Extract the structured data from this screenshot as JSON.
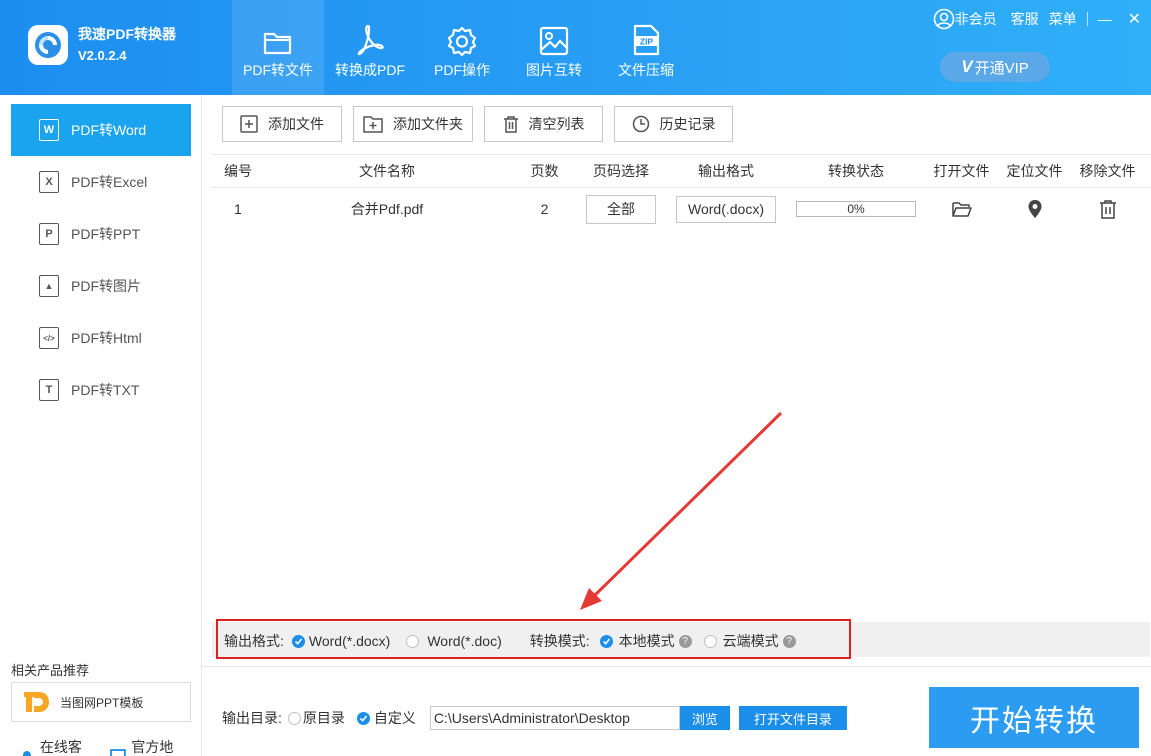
{
  "app": {
    "name": "我速PDF转换器",
    "version": "V2.0.2.4"
  },
  "nav": {
    "items": [
      {
        "label": "PDF转文件",
        "icon": "folder-icon"
      },
      {
        "label": "转换成PDF",
        "icon": "pdf-icon"
      },
      {
        "label": "PDF操作",
        "icon": "gear-icon"
      },
      {
        "label": "图片互转",
        "icon": "image-icon"
      },
      {
        "label": "文件压缩",
        "icon": "zip-icon"
      }
    ],
    "active": 0
  },
  "topbar": {
    "member": "非会员",
    "service": "客服",
    "menu": "菜单",
    "minimize": "—",
    "close": "✕",
    "vip": "开通VIP",
    "vip_badge": "V"
  },
  "sidebar": {
    "items": [
      {
        "label": "PDF转Word",
        "glyph": "W"
      },
      {
        "label": "PDF转Excel",
        "glyph": "X"
      },
      {
        "label": "PDF转PPT",
        "glyph": "P"
      },
      {
        "label": "PDF转图片",
        "glyph": "▲"
      },
      {
        "label": "PDF转Html",
        "glyph": "</>"
      },
      {
        "label": "PDF转TXT",
        "glyph": "T"
      }
    ],
    "active": 0,
    "recommend_title": "相关产品推荐",
    "recommend_product": "当图网PPT模板",
    "footer": {
      "online_service": "在线客服",
      "official_site": "官方地址"
    }
  },
  "toolbar": {
    "add_file": "添加文件",
    "add_folder": "添加文件夹",
    "clear_list": "清空列表",
    "history": "历史记录"
  },
  "table": {
    "headers": [
      "编号",
      "文件名称",
      "页数",
      "页码选择",
      "输出格式",
      "转换状态",
      "打开文件",
      "定位文件",
      "移除文件"
    ],
    "rows": [
      {
        "no": "1",
        "name": "合并Pdf.pdf",
        "pages": "2",
        "page_select": "全部",
        "format": "Word(.docx)",
        "progress_text": "0%",
        "progress": 0
      }
    ]
  },
  "options": {
    "output_format_label": "输出格式:",
    "format_docx": "Word(*.docx)",
    "format_doc": "Word(*.doc)",
    "mode_label": "转换模式:",
    "mode_local": "本地模式",
    "mode_cloud": "云端模式",
    "help": "?"
  },
  "output": {
    "dir_label": "输出目录:",
    "original_dir": "原目录",
    "custom_dir": "自定义",
    "path": "C:\\Users\\Administrator\\Desktop",
    "browse": "浏览",
    "open_dir": "打开文件目录"
  },
  "start_button": "开始转换",
  "colors": {
    "accent": "#1aa3ee",
    "header": "#1c8ef0",
    "highlight_box": "#e02020",
    "annotation_arrow": "#e53935"
  }
}
